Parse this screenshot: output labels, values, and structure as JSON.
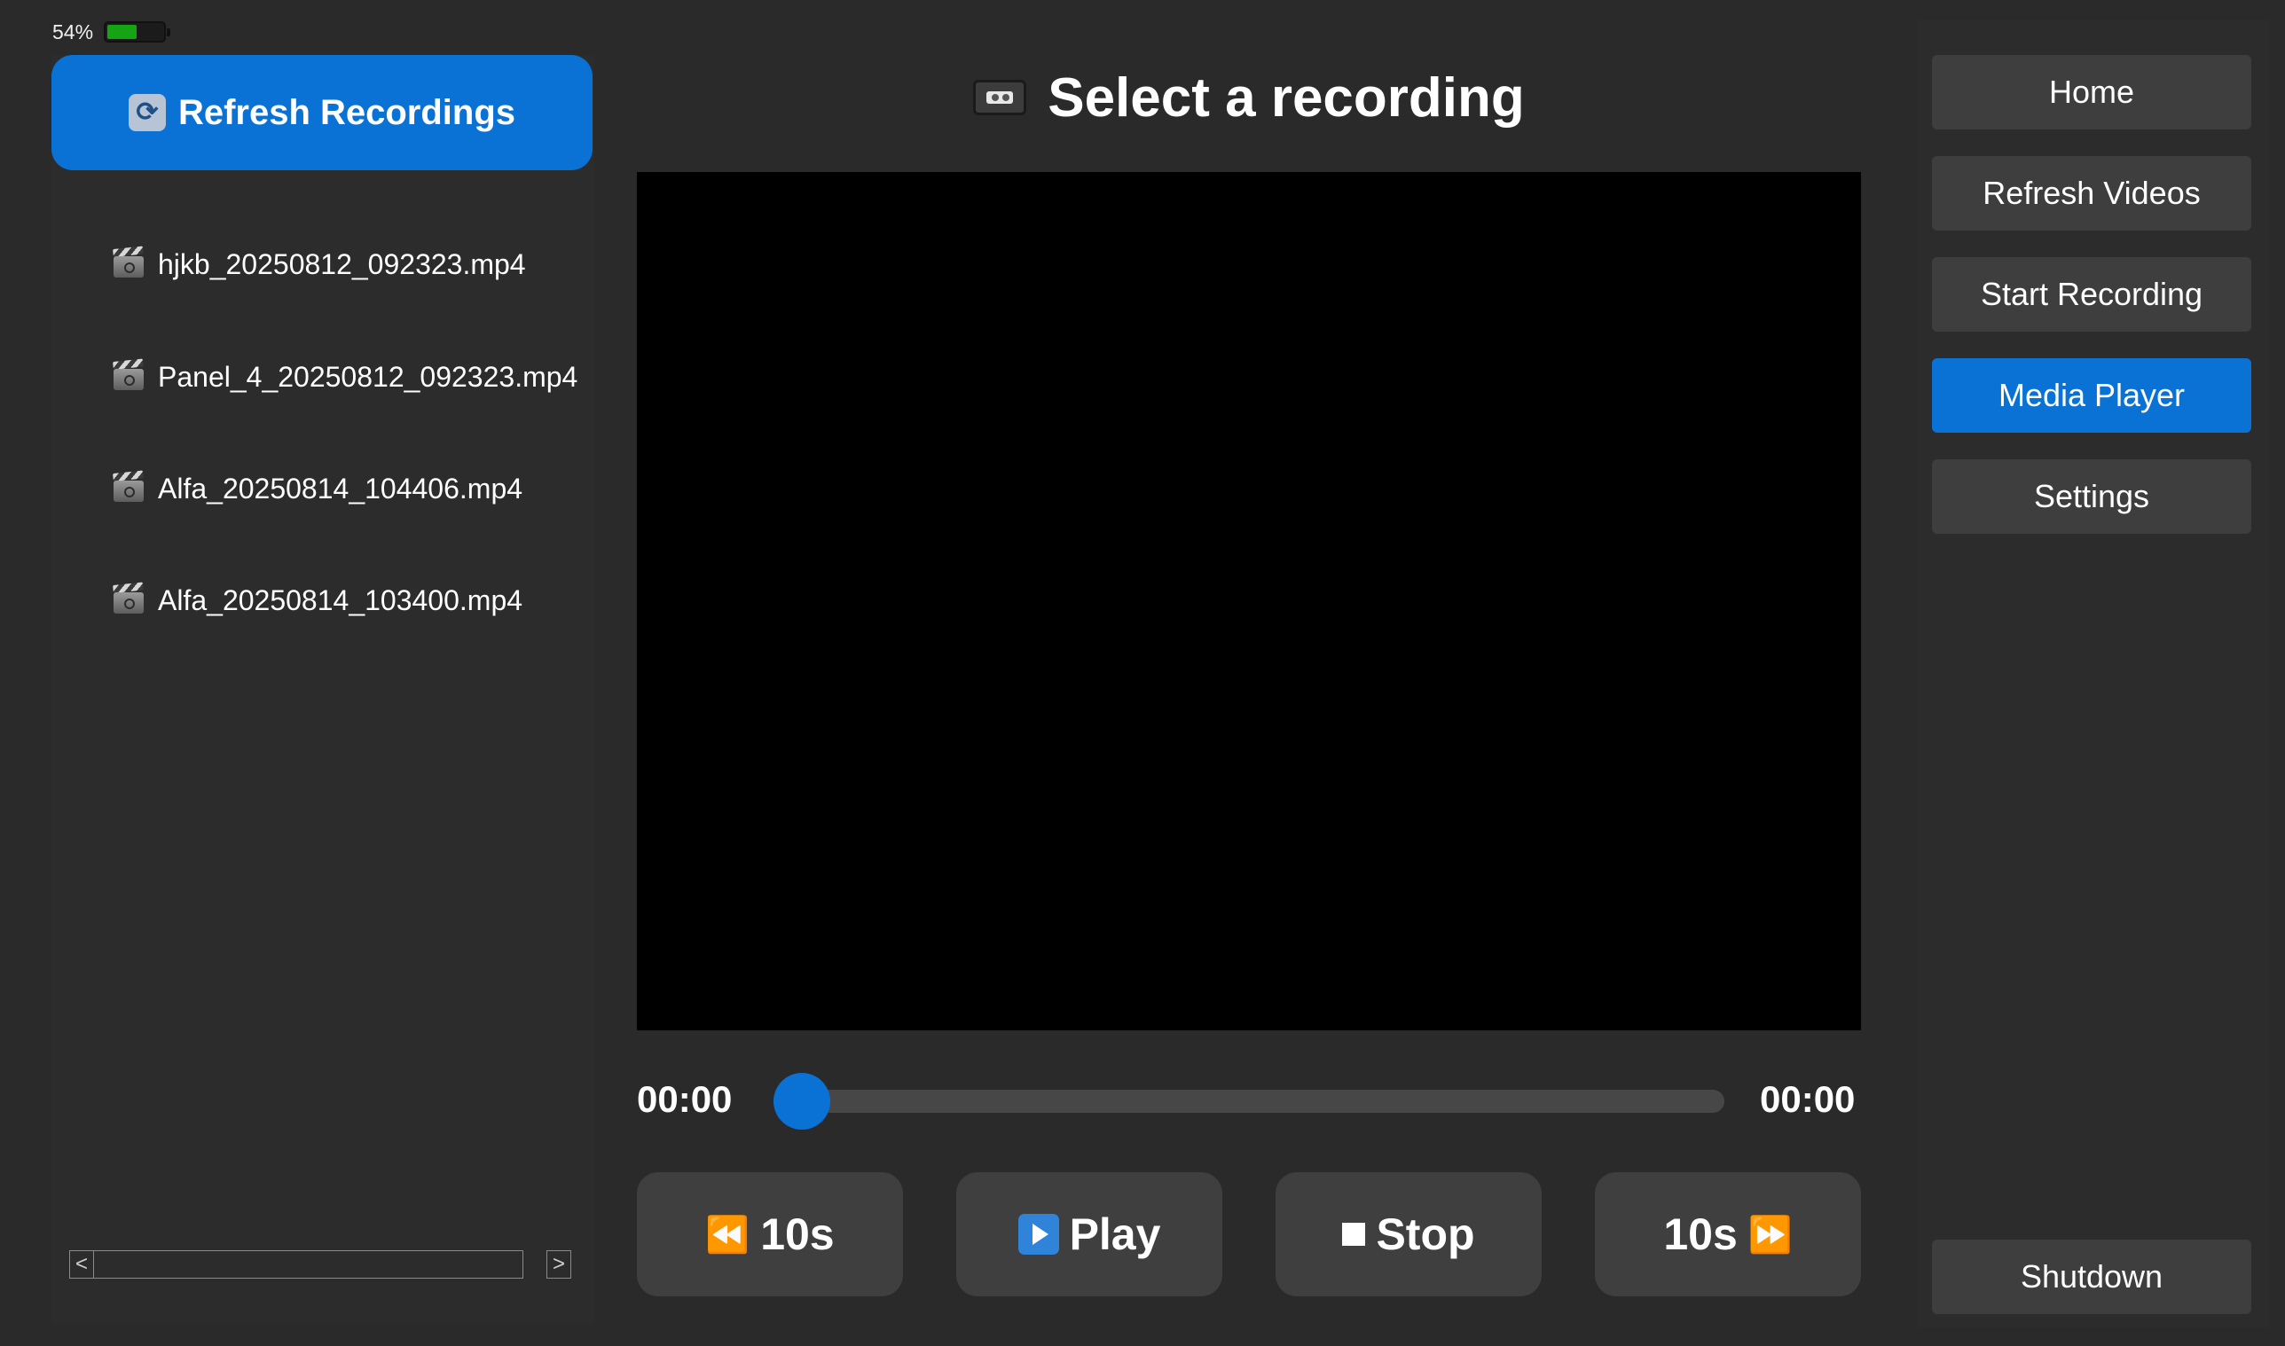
{
  "status": {
    "battery_percent_label": "54%",
    "battery_level": 0.54,
    "battery_color": "#14a414"
  },
  "left_panel": {
    "refresh_button": {
      "icon": "refresh-arrows-icon",
      "label": "Refresh Recordings"
    },
    "files": [
      {
        "icon": "movie-camera-icon",
        "name": "hjkb_20250812_092323.mp4"
      },
      {
        "icon": "movie-camera-icon",
        "name": "Panel_4_20250812_092323.mp4"
      },
      {
        "icon": "movie-camera-icon",
        "name": "Alfa_20250814_104406.mp4"
      },
      {
        "icon": "movie-camera-icon",
        "name": "Alfa_20250814_103400.mp4"
      }
    ],
    "scrollbar": {
      "left_arrow": "<",
      "right_arrow": ">"
    }
  },
  "player": {
    "title_icon": "videocassette-icon",
    "title": "Select a recording",
    "current_time": "00:00",
    "total_time": "00:00",
    "seek_progress": 0,
    "controls": {
      "rewind": {
        "icon": "rewind-icon",
        "glyph": "⏪",
        "label": "10s"
      },
      "play": {
        "icon": "play-button-icon",
        "label": "Play"
      },
      "stop": {
        "icon": "stop-icon",
        "label": "Stop"
      },
      "forward": {
        "icon": "fast-forward-icon",
        "glyph": "⏩",
        "label": "10s"
      }
    }
  },
  "nav": {
    "items": [
      {
        "label": "Home",
        "active": false
      },
      {
        "label": "Refresh Videos",
        "active": false
      },
      {
        "label": "Start Recording",
        "active": false
      },
      {
        "label": "Media Player",
        "active": true
      },
      {
        "label": "Settings",
        "active": false
      }
    ],
    "shutdown_label": "Shutdown"
  },
  "colors": {
    "accent": "#0a72d4",
    "background": "#2a2a2a",
    "panel": "#2c2c2c",
    "button": "#3e3e3e",
    "video": "#000000"
  }
}
